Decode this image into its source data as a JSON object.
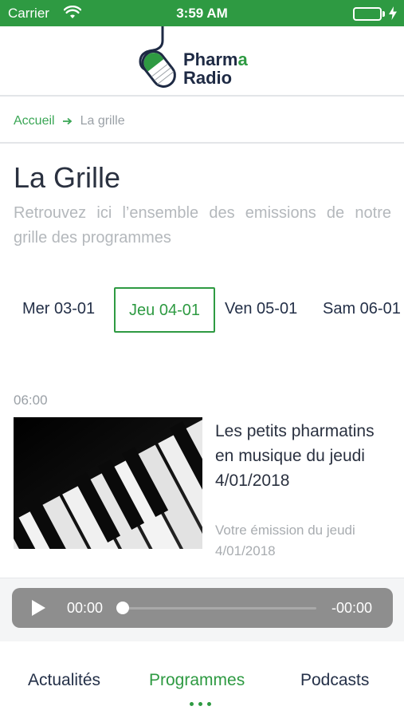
{
  "status_bar": {
    "carrier": "Carrier",
    "time": "3:59 AM",
    "battery_level": 1.0,
    "icons": [
      "wifi-icon",
      "battery-icon",
      "charging-bolt-icon"
    ]
  },
  "header": {
    "logo_line1_main": "Pharm",
    "logo_line1_accent": "a",
    "logo_line2": "Radio",
    "logo_icon": "microphone-logo-icon"
  },
  "breadcrumb": {
    "home": "Accueil",
    "separator_icon": "arrow-right-icon",
    "current": "La grille"
  },
  "page": {
    "title": "La Grille",
    "description": "Retrouvez ici l’ensemble des emissions de notre grille des programmes"
  },
  "day_tabs": [
    {
      "label": "Mer 03-01",
      "active": false
    },
    {
      "label": "Jeu 04-01",
      "active": true
    },
    {
      "label": "Ven 05-01",
      "active": false
    },
    {
      "label": "Sam 06-01",
      "active": false
    }
  ],
  "program": {
    "time": "06:00",
    "thumbnail": "piano-keys-image",
    "title": "Les petits pharmatins en musique du jeudi 4/01/2018",
    "subtitle": "Votre émission du jeudi 4/01/2018"
  },
  "player": {
    "play_icon": "play-icon",
    "current_time": "00:00",
    "remaining_time": "-00:00",
    "progress": 0
  },
  "tab_bar": [
    {
      "label": "Actualités",
      "active": false
    },
    {
      "label": "Programmes",
      "active": true
    },
    {
      "label": "Podcasts",
      "active": false
    }
  ],
  "tab_bar_more_icon": "more-dots-icon",
  "colors": {
    "brand_green": "#2e9a42",
    "text_dark": "#243048",
    "text_muted": "#a8acb0",
    "player_bg": "#8e8e8e"
  }
}
